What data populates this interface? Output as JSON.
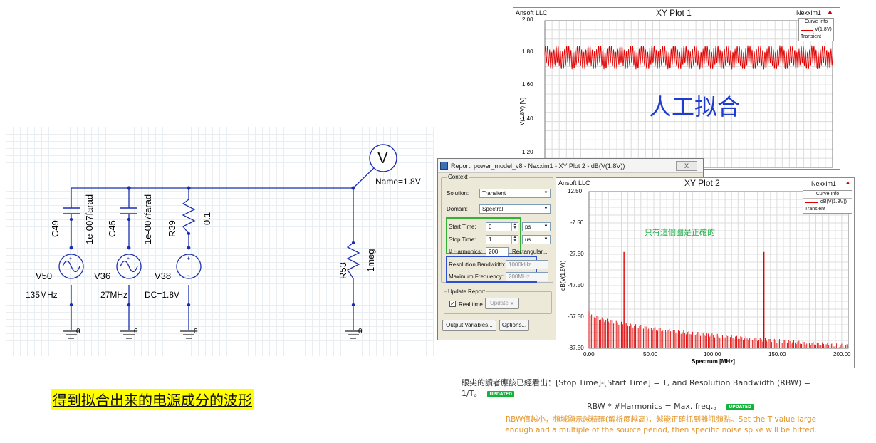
{
  "schematic": {
    "probe": {
      "symbol": "V",
      "name_label": "Name=1.8V"
    },
    "components": [
      {
        "ref": "C49",
        "value": "1e-007farad"
      },
      {
        "ref": "C45",
        "value": "1e-007farad"
      },
      {
        "ref": "R39",
        "value": "0.1"
      },
      {
        "ref": "R53",
        "value": "1meg"
      }
    ],
    "sources": [
      {
        "ref": "V50",
        "value": "135MHz"
      },
      {
        "ref": "V36",
        "value": "27MHz"
      },
      {
        "ref": "V38",
        "value": "DC=1.8V"
      }
    ],
    "ground_label": "0"
  },
  "caption_left": "得到拟合出来的电源成分的波形",
  "plot1": {
    "company": "Ansoft LLC",
    "title": "XY Plot 1",
    "tool": "Nexxim1",
    "y_axis_label": "V(1.8V) [V]",
    "curve_info_title": "Curve Info",
    "curve_name": "V(1.8V)",
    "curve_sub": "Transient",
    "overlay_text": "人工拟合",
    "curve_color": "#e00000",
    "chart_data": {
      "type": "line",
      "ylabel": "V(1.8V) [V]",
      "y_ticks": [
        "2.00",
        "1.80",
        "1.60",
        "1.40",
        "1.20"
      ],
      "ylim": [
        1.2,
        2.0
      ],
      "series": [
        {
          "name": "V(1.8V)",
          "description_range": [
            1.73,
            1.87
          ]
        }
      ]
    }
  },
  "dialog": {
    "title": "Report: power_model_v8 - Nexxim1 - XY Plot 2 - dB(V(1.8V))",
    "close_label": "X",
    "context_label": "Context",
    "solution_label": "Solution:",
    "solution_value": "Transient",
    "domain_label": "Domain:",
    "domain_value": "Spectral",
    "start_time_label": "Start Time:",
    "start_time_value": "0",
    "start_time_unit": "ps",
    "stop_time_label": "Stop Time:",
    "stop_time_value": "1",
    "stop_time_unit": "us",
    "harmonics_label": "# Harmonics:",
    "harmonics_value": "200",
    "window_value": "Rectangular...",
    "rbw_label": "Resolution Bandwidth:",
    "rbw_value": "1000kHz",
    "max_freq_label": "Maximum Frequency:",
    "max_freq_value": "200MHz",
    "update_report_label": "Update Report",
    "realtime_label": "Real time",
    "update_button": "Update",
    "output_vars_button": "Output Variables...",
    "options_button": "Options..."
  },
  "plot2": {
    "company": "Ansoft LLC",
    "title": "XY Plot 2",
    "tool": "Nexxim1",
    "y_axis_label": "dB(V(1.8V))",
    "x_axis_label": "Spectrum [MHz]",
    "curve_info_title": "Curve Info",
    "curve_name": "dB(V(1.8V))",
    "curve_sub": "Transient",
    "annotation": "只有這個圖是正確的",
    "curve_color": "#e00000",
    "chart_data": {
      "type": "line",
      "xlabel": "Spectrum [MHz]",
      "ylabel": "dB(V(1.8V))",
      "x_ticks": [
        "0.00",
        "50.00",
        "100.00",
        "150.00",
        "200.00"
      ],
      "y_ticks": [
        "12.50",
        "-7.50",
        "-27.50",
        "-47.50",
        "-67.50",
        "-87.50"
      ],
      "xlim": [
        0,
        200
      ],
      "ylim": [
        -87.5,
        12.5
      ],
      "series": [
        {
          "name": "dB(V(1.8V))",
          "spikes": [
            {
              "x": 27,
              "y": -26
            },
            {
              "x": 135,
              "y": -26
            }
          ],
          "noise_floor_start": -64,
          "noise_floor_end": -86
        }
      ]
    }
  },
  "notes": {
    "line1": "眼尖的讀者應該已經看出：[Stop Time]-[Start Time] = T, and Resolution Bandwidth (RBW) =",
    "line1b": "1/T。",
    "line2": "RBW * #Harmonics = Max. freq.。",
    "line3": "RBW值越小，頻域顯示越精確(解析度越高)，越能正確抓到雜訊頻點。Set the T value large",
    "line4": "enough and a multiple of the source period, then specific noise spike will be hitted.",
    "badge": "UPDATED"
  }
}
